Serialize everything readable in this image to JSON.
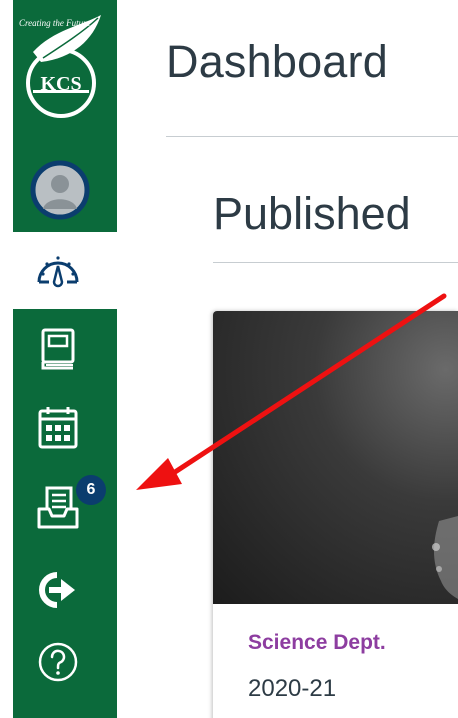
{
  "sidebar": {
    "logo": {
      "text": "KCS",
      "tagline": "Creating the Future"
    },
    "items": [
      {
        "name": "account",
        "icon": "user-avatar-icon"
      },
      {
        "name": "dashboard",
        "icon": "dashboard-gauge-icon"
      },
      {
        "name": "courses",
        "icon": "book-icon"
      },
      {
        "name": "calendar",
        "icon": "calendar-icon"
      },
      {
        "name": "inbox",
        "icon": "inbox-icon",
        "badge": "6"
      },
      {
        "name": "logout",
        "icon": "logout-arrow-icon"
      },
      {
        "name": "help",
        "icon": "help-question-icon"
      }
    ],
    "colors": {
      "brand": "#0b6a3b",
      "badge": "#0b3d6e"
    }
  },
  "main": {
    "title": "Dashboard",
    "section_title": "Published",
    "card": {
      "course": "Science Dept.",
      "term": "2020-21"
    }
  },
  "annotation": {
    "color": "#ee1111",
    "icon": "red-arrow-annotation"
  }
}
